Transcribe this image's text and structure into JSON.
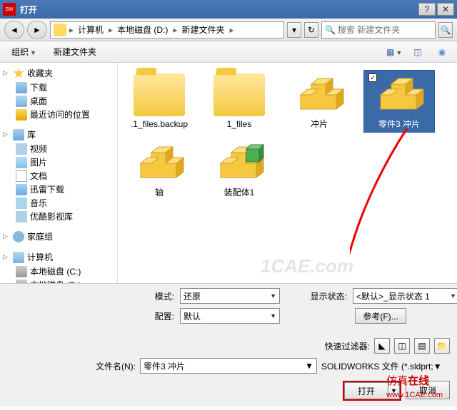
{
  "title": "打开",
  "breadcrumb": {
    "p1": "计算机",
    "p2": "本地磁盘 (D:)",
    "p3": "新建文件夹"
  },
  "search": {
    "placeholder": "搜索 新建文件夹"
  },
  "toolbar": {
    "organize": "组织",
    "newfolder": "新建文件夹"
  },
  "tree": {
    "fav": "收藏夹",
    "downloads": "下载",
    "desktop": "桌面",
    "recent": "最近访问的位置",
    "lib": "库",
    "videos": "视频",
    "pictures": "图片",
    "docs": "文档",
    "xunlei": "迅雷下载",
    "music": "音乐",
    "youku": "优酷影视库",
    "homegroup": "家庭组",
    "computer": "计算机",
    "diskc": "本地磁盘 (C:)",
    "diskd_partial": "本地磁盘 (D:)"
  },
  "files": [
    {
      "name": ".1_files.backup",
      "type": "folder"
    },
    {
      "name": "1_files",
      "type": "folder"
    },
    {
      "name": "冲片",
      "type": "part"
    },
    {
      "name": "零件3 冲片",
      "type": "part",
      "selected": true
    },
    {
      "name": "轴",
      "type": "part"
    },
    {
      "name": "装配体1",
      "type": "asm"
    }
  ],
  "form": {
    "mode_label": "模式:",
    "mode_value": "还原",
    "config_label": "配置:",
    "config_value": "默认",
    "display_label": "显示状态:",
    "display_value": "<默认>_显示状态 1",
    "refs_btn": "参考(F)...",
    "quickfilter_label": "快速过滤器:",
    "filename_label": "文件名(N):",
    "filename_value": "零件3 冲片",
    "filetype_value": "SOLIDWORKS 文件 (*.sldprt;",
    "open_btn": "打开",
    "cancel_btn": "取消"
  },
  "watermark": "1CAE.com",
  "watermark2_a": "仿真",
  "watermark2_b": "在线",
  "watermark2_c": "www.1CAE.com"
}
